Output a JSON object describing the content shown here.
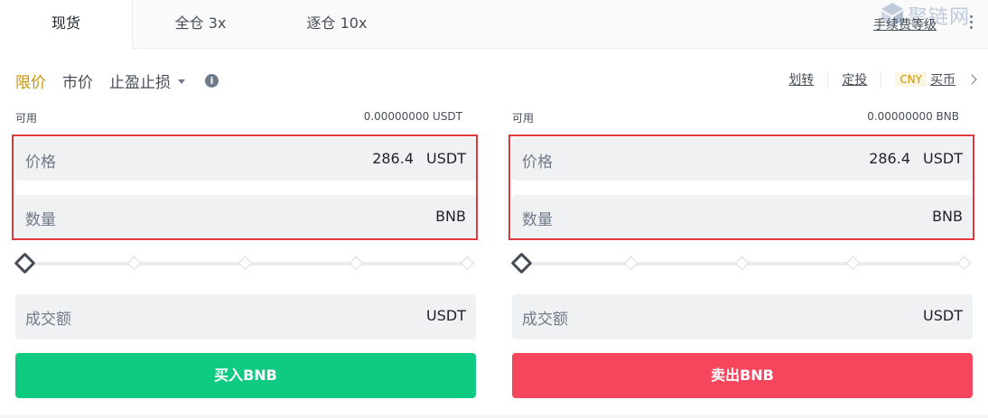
{
  "tabs": [
    {
      "label": "现货",
      "active": true
    },
    {
      "label": "全仓 3x",
      "active": false
    },
    {
      "label": "逐仓 10x",
      "active": false
    }
  ],
  "header": {
    "fee_link": "手续费等级",
    "watermark": "聚链网"
  },
  "order_types": [
    {
      "label": "限价",
      "active": true
    },
    {
      "label": "市价",
      "active": false
    },
    {
      "label": "止盈止损",
      "active": false
    }
  ],
  "right_actions": {
    "transfer": "划转",
    "auto_invest": "定投",
    "currency": "CNY",
    "buy_crypto": "买币"
  },
  "buy_panel": {
    "available_label": "可用",
    "available_value": "0.00000000 USDT",
    "price_label": "价格",
    "price_value": "286.4",
    "price_unit": "USDT",
    "qty_label": "数量",
    "qty_value": "",
    "qty_unit": "BNB",
    "slider_percent": 0,
    "total_label": "成交额",
    "total_value": "",
    "total_unit": "USDT",
    "button_label": "买入BNB"
  },
  "sell_panel": {
    "available_label": "可用",
    "available_value": "0.00000000 BNB",
    "price_label": "价格",
    "price_value": "286.4",
    "price_unit": "USDT",
    "qty_label": "数量",
    "qty_value": "",
    "qty_unit": "BNB",
    "slider_percent": 0,
    "total_label": "成交额",
    "total_value": "",
    "total_unit": "USDT",
    "button_label": "卖出BNB"
  },
  "colors": {
    "accent": "#c99400",
    "buy": "#0ecb81",
    "sell": "#f6465d",
    "highlight": "#e03a3e"
  }
}
